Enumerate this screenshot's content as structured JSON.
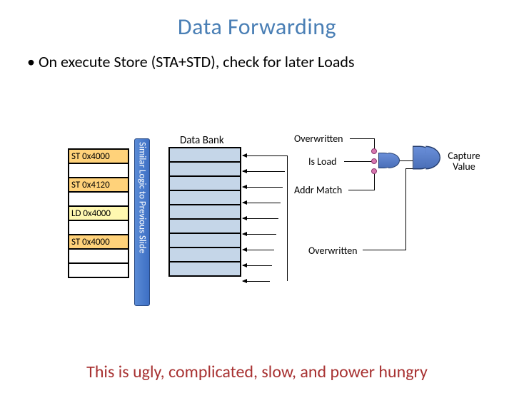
{
  "title": "Data Forwarding",
  "bullet": "On execute Store (STA+STD), check for later Loads",
  "entries": [
    {
      "label": "ST 0x4000",
      "type": "st"
    },
    {
      "label": "",
      "type": ""
    },
    {
      "label": "ST 0x4120",
      "type": "st"
    },
    {
      "label": "",
      "type": ""
    },
    {
      "label": "LD 0x4000",
      "type": "ld"
    },
    {
      "label": "",
      "type": ""
    },
    {
      "label": "ST 0x4000",
      "type": "st"
    },
    {
      "label": "",
      "type": ""
    },
    {
      "label": "",
      "type": ""
    }
  ],
  "similar_label": "Similar Logic to Previous Slide",
  "databank_label": "Data Bank",
  "labels": {
    "overwritten1": "Overwritten",
    "isload": "Is Load",
    "addrmatch": "Addr Match",
    "overwritten2": "Overwritten",
    "capture": "Capture Value"
  },
  "bottom": "This is ugly, complicated, slow, and power hungry",
  "colors": {
    "title": "#4a7fb5",
    "store_bg": "#ffd27a",
    "load_bg": "#fff8b0",
    "databank_bg": "#c5d6e8",
    "bottom_text": "#a83232"
  },
  "chart_data": {
    "type": "table",
    "description": "Pipeline diagram: a queue of store/load entries on the left, a 'Similar Logic to Previous Slide' block, a Data Bank table with arrows feeding into logic gates (Overwritten AND NOT, Is Load, Addr Match) combined into Capture Value signal; Overwritten feeds back below.",
    "queue_entries": [
      "ST 0x4000",
      "",
      "ST 0x4120",
      "",
      "LD 0x4000",
      "",
      "ST 0x4000",
      "",
      ""
    ],
    "databank_rows": 9,
    "signals": [
      "Overwritten",
      "Is Load",
      "Addr Match",
      "Overwritten"
    ],
    "output": "Capture Value"
  }
}
